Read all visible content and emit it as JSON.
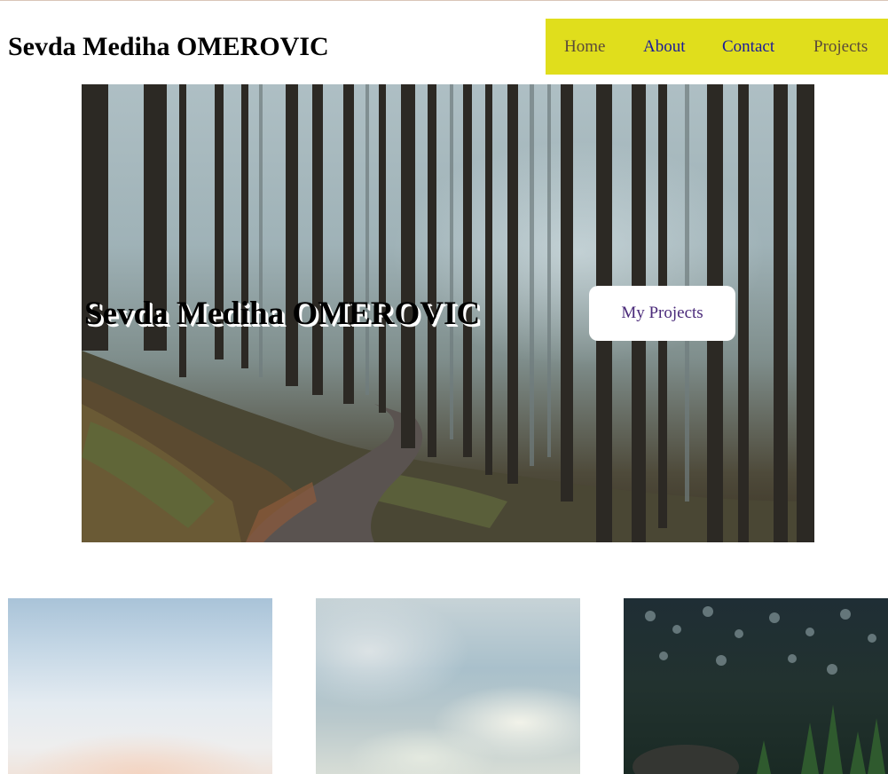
{
  "header": {
    "site_title": "Sevda Mediha OMEROVIC"
  },
  "nav": {
    "items": [
      {
        "label": "Home"
      },
      {
        "label": "About"
      },
      {
        "label": "Contact"
      },
      {
        "label": "Projects"
      }
    ],
    "background_color": "#e0de1c"
  },
  "hero": {
    "title": "Sevda Mediha OMEROVIC",
    "button_label": "My Projects",
    "image": "misty-forest-trail-photo"
  },
  "gallery": {
    "cards": [
      {
        "image": "hazy-sky-photo"
      },
      {
        "image": "cloudy-sky-photo"
      },
      {
        "image": "forested-hillside-photo"
      }
    ]
  }
}
